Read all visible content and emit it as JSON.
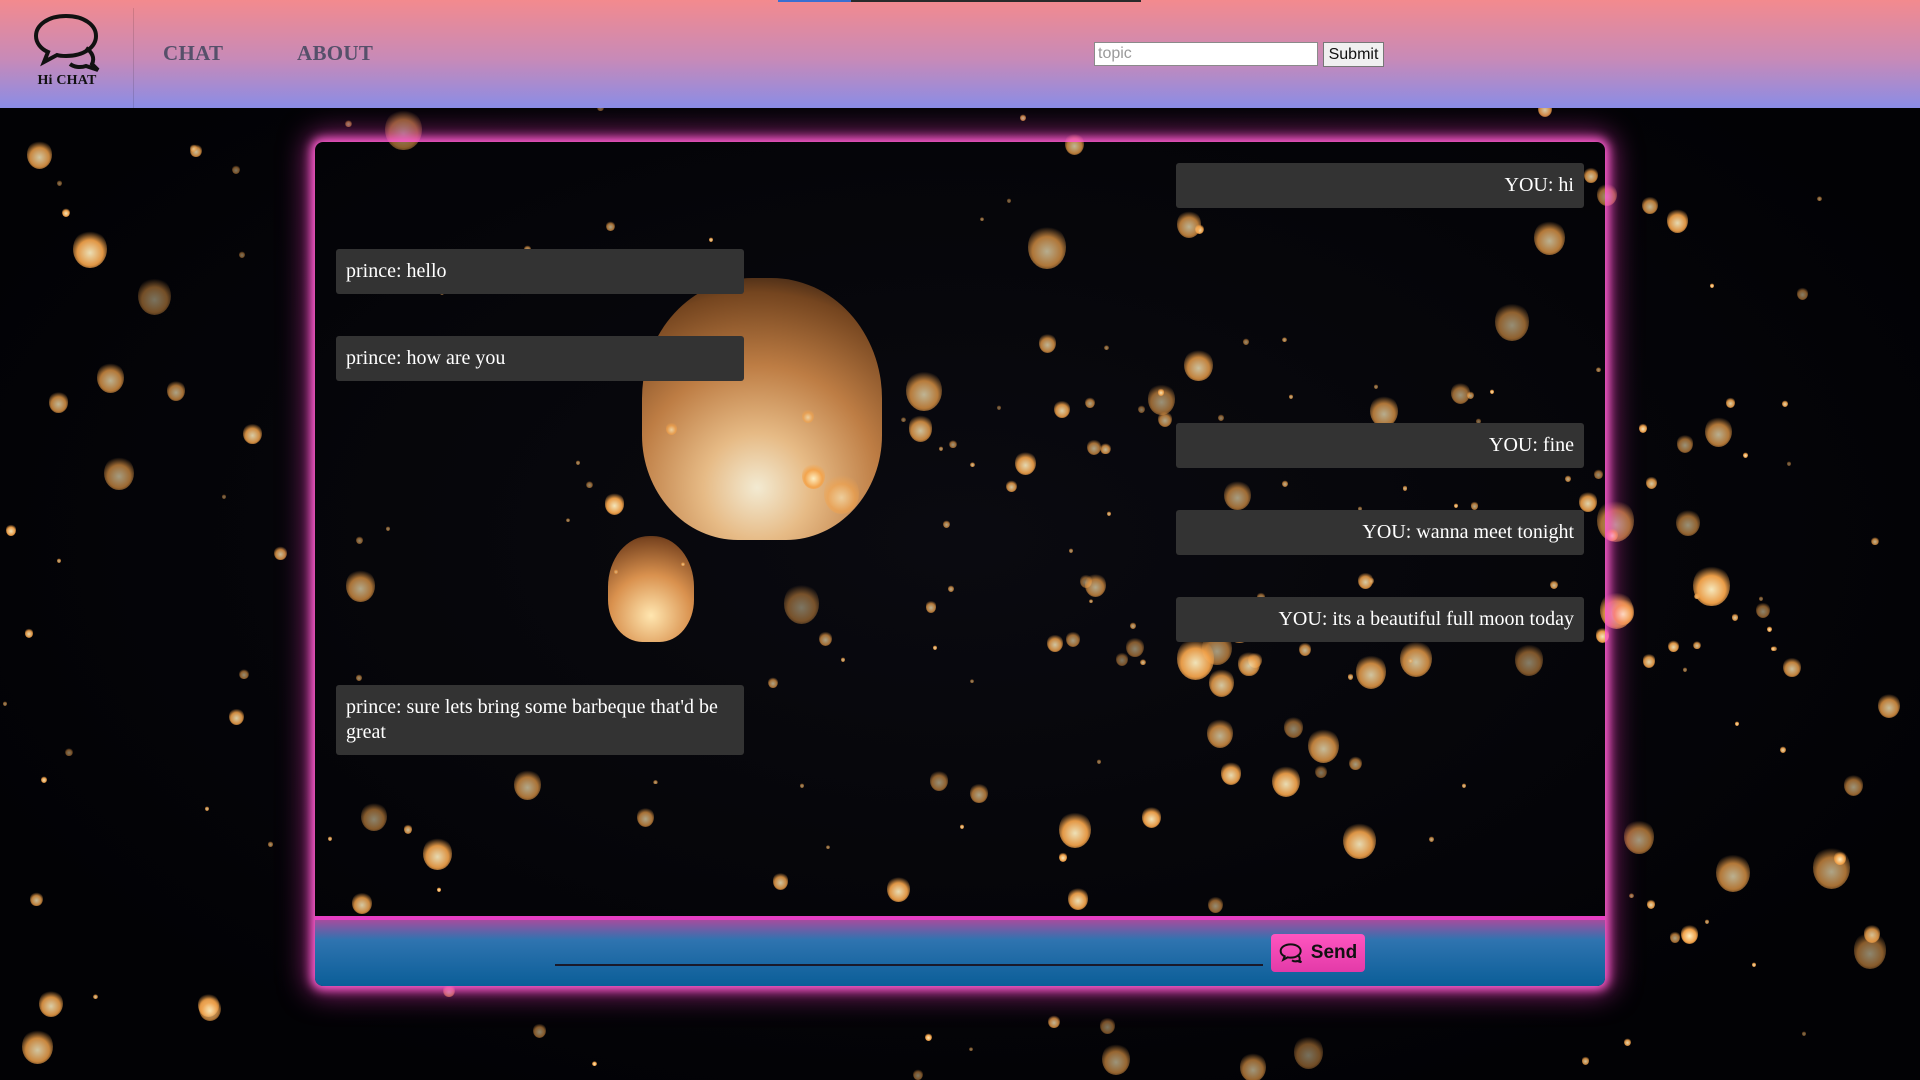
{
  "header": {
    "logo_text": "Hi CHAT",
    "nav": [
      {
        "label": "CHAT"
      },
      {
        "label": "ABOUT"
      }
    ],
    "topic_input": {
      "placeholder": "topic",
      "value": ""
    },
    "submit_label": "Submit",
    "progress": 0.2
  },
  "chat": {
    "messages": [
      {
        "side": "right",
        "text": "YOU: hi"
      },
      {
        "side": "left",
        "text": "prince: hello"
      },
      {
        "side": "left",
        "text": "prince: how are you"
      },
      {
        "side": "right",
        "text": "YOU: fine"
      },
      {
        "side": "right",
        "text": "YOU: wanna meet tonight"
      },
      {
        "side": "right",
        "text": "YOU: its a beautiful full moon today"
      },
      {
        "side": "left",
        "text": "prince: sure lets bring some barbeque that'd be great"
      }
    ],
    "input": {
      "placeholder": "",
      "value": ""
    },
    "send_label": "Send"
  },
  "colors": {
    "header_top": "#f38a8e",
    "header_bottom": "#8a8ce6",
    "panel_glow": "#ff5fd0",
    "bubble": "#333333",
    "send_button": "#ff55c0"
  },
  "icons": {
    "logo": "chat-bubbles-icon",
    "send": "chat-bubbles-icon"
  }
}
